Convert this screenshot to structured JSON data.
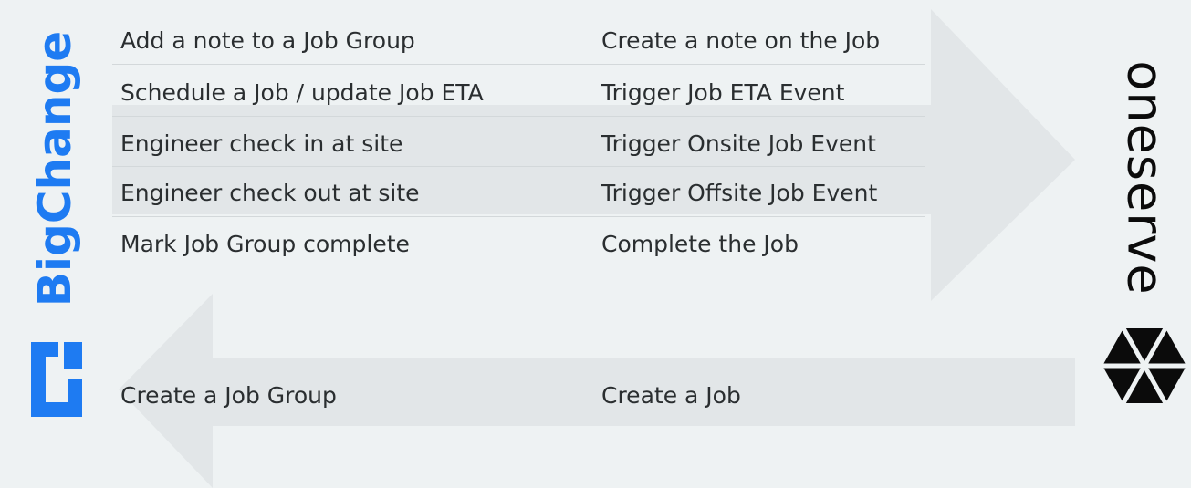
{
  "brands": {
    "left": "BigChange",
    "right": "oneserve",
    "left_color": "#1e7bf2",
    "right_color": "#0b0b0b"
  },
  "outbound_rows": [
    {
      "from": "Add a note to a Job Group",
      "to": "Create a note on the Job"
    },
    {
      "from": "Schedule a Job / update Job ETA",
      "to": "Trigger Job ETA Event"
    },
    {
      "from": "Engineer check in at site",
      "to": "Trigger Onsite Job Event"
    },
    {
      "from": "Engineer check out at site",
      "to": "Trigger Offsite Job Event"
    },
    {
      "from": "Mark Job Group complete",
      "to": "Complete the Job"
    }
  ],
  "inbound_rows": [
    {
      "from": "Create a Job Group",
      "to": "Create a Job"
    }
  ],
  "icons": [
    "bigchange-logo-icon",
    "oneserve-hexagon-icon"
  ],
  "arrow_color": "#e2e6e8"
}
